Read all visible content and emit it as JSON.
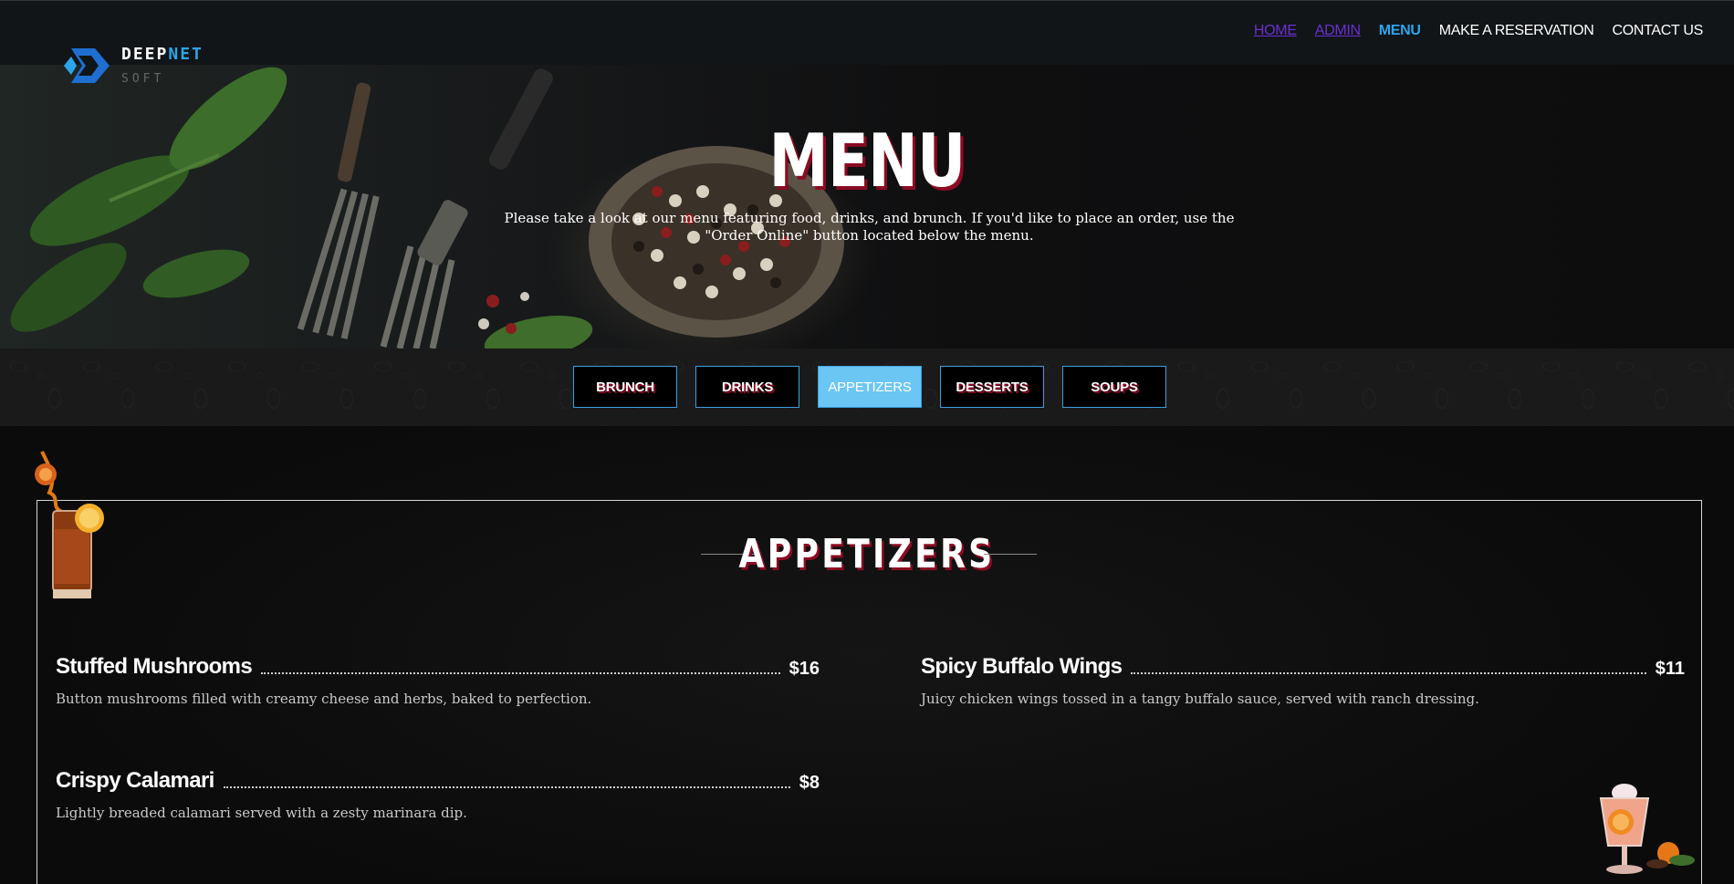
{
  "brand": {
    "name_part1": "DEEP",
    "name_part2": "NET",
    "tagline": "SOFT",
    "accent_color": "#2da4e9"
  },
  "nav": {
    "items": [
      {
        "label": "HOME",
        "state": "visited"
      },
      {
        "label": "ADMIN",
        "state": "visited"
      },
      {
        "label": "MENU",
        "state": "active"
      },
      {
        "label": "MAKE A RESERVATION",
        "state": "normal"
      },
      {
        "label": "CONTACT US",
        "state": "normal"
      }
    ]
  },
  "hero": {
    "title": "MENU",
    "description": "Please take a look at our menu featuring food, drinks, and brunch. If you'd like to place an order, use the \"Order Online\" button located below the menu."
  },
  "tabs": [
    {
      "label": "BRUNCH",
      "active": false
    },
    {
      "label": "DRINKS",
      "active": false
    },
    {
      "label": "APPETIZERS",
      "active": true
    },
    {
      "label": "DESSERTS",
      "active": false
    },
    {
      "label": "SOUPS",
      "active": false
    }
  ],
  "section": {
    "title": "APPETIZERS",
    "items": [
      {
        "name": "Stuffed Mushrooms",
        "price": "$16",
        "description": "Button mushrooms filled with creamy cheese and herbs, baked to perfection."
      },
      {
        "name": "Spicy Buffalo Wings",
        "price": "$11",
        "description": "Juicy chicken wings tossed in a tangy buffalo sauce, served with ranch dressing."
      },
      {
        "name": "Crispy Calamari",
        "price": "$8",
        "description": "Lightly breaded calamari served with a zesty marinara dip."
      }
    ]
  },
  "colors": {
    "title_shadow": "#8a0b22",
    "tab_border": "#3aa0df",
    "tab_active_bg": "#6cc6f3",
    "nav_active": "#2da4e9",
    "nav_visited": "#6a2fd0"
  }
}
